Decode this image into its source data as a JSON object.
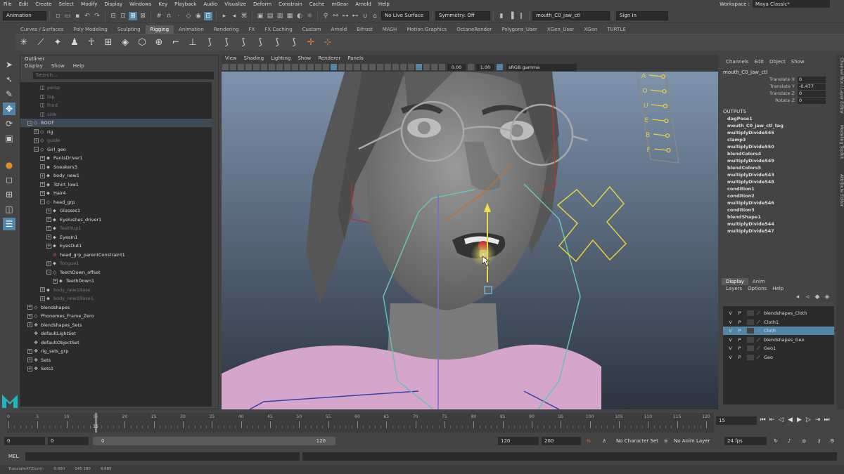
{
  "menubar": {
    "items": [
      "File",
      "Edit",
      "Create",
      "Select",
      "Modify",
      "Display",
      "Windows",
      "Key",
      "Playback",
      "Audio",
      "Visualize",
      "Deform",
      "Constrain",
      "Cache",
      "mGear",
      "Arnold",
      "Help"
    ],
    "workspace_label": "Workspace :",
    "workspace_value": "Maya Classic*"
  },
  "statusline": {
    "mode": "Animation",
    "live_surface": "No Live Surface",
    "symmetry": "Symmetry: Off",
    "object_name": "mouth_C0_jaw_ctl",
    "sign_in": "Sign In"
  },
  "shelf_tabs": [
    "Curves / Surfaces",
    "Poly Modeling",
    "Sculpting",
    "Rigging",
    "Animation",
    "Rendering",
    "FX",
    "FX Caching",
    "Custom",
    "Arnold",
    "Bifrost",
    "MASH",
    "Motion Graphics",
    "OctaneRender",
    "Polygons_User",
    "XGen_User",
    "XGen",
    "TURTLE"
  ],
  "shelf_active": "Rigging",
  "shelf_icons": [
    "✳",
    "⟋",
    "✦",
    "♟",
    "☥",
    "⊞",
    "◈",
    "⬡",
    "⊕",
    "⌐",
    "⊥",
    "⟆",
    "⟆",
    "⟆",
    "⟆",
    "⟆",
    "⟆",
    "✛",
    "⊹"
  ],
  "outliner": {
    "title": "Outliner",
    "menu": [
      "Display",
      "Show",
      "Help"
    ],
    "search_placeholder": "Search...",
    "items": [
      {
        "label": "persp",
        "indent": 1,
        "icon": "◫",
        "dim": true
      },
      {
        "label": "top",
        "indent": 1,
        "icon": "◫",
        "dim": true
      },
      {
        "label": "front",
        "indent": 1,
        "icon": "◫",
        "dim": true
      },
      {
        "label": "side",
        "indent": 1,
        "icon": "◫",
        "dim": true
      },
      {
        "label": "ROOT",
        "indent": 0,
        "icon": "◇",
        "expander": "−",
        "selected": true
      },
      {
        "label": "rig",
        "indent": 1,
        "icon": "◇",
        "expander": "+"
      },
      {
        "label": "guide",
        "indent": 1,
        "icon": "◇",
        "expander": "+",
        "dim": true
      },
      {
        "label": "Girl_geo",
        "indent": 1,
        "icon": "◇",
        "expander": "−"
      },
      {
        "label": "PantsDriver1",
        "indent": 2,
        "icon": "⬥",
        "expander": "+"
      },
      {
        "label": "Sneakers3",
        "indent": 2,
        "icon": "⬥",
        "expander": "+"
      },
      {
        "label": "body_new1",
        "indent": 2,
        "icon": "⬥",
        "expander": "+"
      },
      {
        "label": "Tshirt_low1",
        "indent": 2,
        "icon": "⬥",
        "expander": "+"
      },
      {
        "label": "Hair4",
        "indent": 2,
        "icon": "⬥",
        "expander": "+"
      },
      {
        "label": "head_grp",
        "indent": 2,
        "icon": "◇",
        "expander": "−"
      },
      {
        "label": "Glasses1",
        "indent": 3,
        "icon": "⬥",
        "expander": "+"
      },
      {
        "label": "Eyelushes_driver1",
        "indent": 3,
        "icon": "⬥",
        "expander": "+"
      },
      {
        "label": "TeethUp1",
        "indent": 3,
        "icon": "⬥",
        "expander": "+",
        "dim": true
      },
      {
        "label": "EyesIn1",
        "indent": 3,
        "icon": "⬥",
        "expander": "+"
      },
      {
        "label": "EyesOut1",
        "indent": 3,
        "icon": "⬥",
        "expander": "+"
      },
      {
        "label": "head_grp_parentConstraint1",
        "indent": 3,
        "icon": "⊘"
      },
      {
        "label": "Tongue1",
        "indent": 3,
        "icon": "⬥",
        "expander": "+",
        "dim": true
      },
      {
        "label": "TeethDown_offset",
        "indent": 3,
        "icon": "◇",
        "expander": "−"
      },
      {
        "label": "TeethDown1",
        "indent": 4,
        "icon": "⬥",
        "expander": "+"
      },
      {
        "label": "body_new1Base",
        "indent": 2,
        "icon": "⬥",
        "expander": "+",
        "dim": true
      },
      {
        "label": "body_new1Base1",
        "indent": 2,
        "icon": "⬥",
        "expander": "+",
        "dim": true
      },
      {
        "label": "blendshapes",
        "indent": 0,
        "icon": "◇",
        "expander": "+"
      },
      {
        "label": "Phonemes_Frame_Zero",
        "indent": 0,
        "icon": "◇",
        "expander": "+"
      },
      {
        "label": "blendshapes_Sets",
        "indent": 0,
        "icon": "❖",
        "expander": "+"
      },
      {
        "label": "defaultLightSet",
        "indent": 0,
        "icon": "❖"
      },
      {
        "label": "defaultObjectSet",
        "indent": 0,
        "icon": "❖"
      },
      {
        "label": "rig_sets_grp",
        "indent": 0,
        "icon": "❖",
        "expander": "+"
      },
      {
        "label": "Sets",
        "indent": 0,
        "icon": "❖",
        "expander": "+"
      },
      {
        "label": "Sets1",
        "indent": 0,
        "icon": "❖",
        "expander": "+"
      }
    ]
  },
  "viewport": {
    "menu": [
      "View",
      "Shading",
      "Lighting",
      "Show",
      "Renderer",
      "Panels"
    ],
    "exposure": "0.00",
    "gamma": "1.00",
    "color_space": "sRGB gamma",
    "chart_letters": [
      "A",
      "O",
      "U",
      "E",
      "B",
      "F"
    ]
  },
  "channelbox": {
    "menu": [
      "Channels",
      "Edit",
      "Object",
      "Show"
    ],
    "object": "mouth_C0_jaw_ctl",
    "attributes": [
      {
        "name": "Translate X",
        "value": "0"
      },
      {
        "name": "Translate Y",
        "value": "-0.477"
      },
      {
        "name": "Translate Z",
        "value": "0"
      },
      {
        "name": "Rotate Z",
        "value": "0"
      }
    ],
    "outputs_label": "OUTPUTS",
    "outputs": [
      "dagPose1",
      "mouth_C0_jaw_ctl_tag",
      "multiplyDivide545",
      "clamp3",
      "multiplyDivide550",
      "blendColors4",
      "multiplyDivide549",
      "blendColors5",
      "multiplyDivide543",
      "multiplyDivide548",
      "condition1",
      "condition2",
      "multiplyDivide546",
      "condition3",
      "blendShape1",
      "multiplyDivide544",
      "multiplyDivide547"
    ]
  },
  "side_tabs": [
    "Channel Box / Layer Editor",
    "Modeling Toolkit",
    "Attribute Editor"
  ],
  "layers": {
    "tabs": [
      "Display",
      "Anim"
    ],
    "menu": [
      "Layers",
      "Options",
      "Help"
    ],
    "rows": [
      {
        "v": "V",
        "p": "P",
        "name": "blendshapes_Cloth",
        "selected": false
      },
      {
        "v": "V",
        "p": "P",
        "name": "Cloth1",
        "selected": false
      },
      {
        "v": "V",
        "p": "P",
        "name": "Cloth",
        "selected": true
      },
      {
        "v": "V",
        "p": "P",
        "name": "blendshapes_Geo",
        "selected": false
      },
      {
        "v": "V",
        "p": "P",
        "name": "Geo1",
        "selected": false
      },
      {
        "v": "V",
        "p": "P",
        "name": "Geo",
        "selected": false
      }
    ]
  },
  "timeline": {
    "start": 0,
    "end": 120,
    "labels": [
      "0",
      "5",
      "10",
      "15",
      "20",
      "25",
      "30",
      "35",
      "40",
      "45",
      "50",
      "55",
      "60",
      "65",
      "70",
      "75",
      "80",
      "85",
      "90",
      "95",
      "100",
      "105",
      "110",
      "115",
      "120"
    ],
    "current_frame": "15",
    "current_value": 15
  },
  "range": {
    "anim_start": "0",
    "play_start": "0",
    "range_start_label": "0",
    "range_end_label": "120",
    "play_end": "120",
    "anim_end": "200",
    "character_set": "No Character Set",
    "anim_layer": "No Anim Layer",
    "fps": "24 fps"
  },
  "cmdline": {
    "label": "MEL"
  },
  "helpline": {
    "items": [
      "TranslateXYZ(cm):",
      "0.000",
      "145.180",
      "9.685"
    ]
  }
}
